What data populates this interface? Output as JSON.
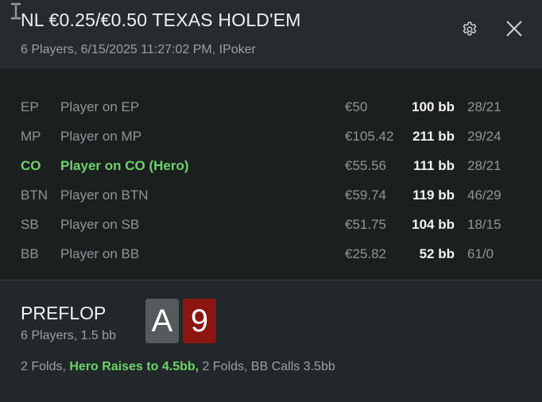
{
  "colors": {
    "background": "#22272a",
    "header_background": "#262b2e",
    "players_background": "#1b201f",
    "hero_accent": "#6cd36a",
    "card_a_background": "#555a5c",
    "card_9_background": "#8b1510"
  },
  "header": {
    "title": "NL €0.25/€0.50 TEXAS HOLD'EM",
    "subtitle": "6 Players, 6/15/2025 11:27:02 PM, IPoker",
    "settings_icon": "gear-icon",
    "close_icon": "close-icon"
  },
  "players": [
    {
      "position": "EP",
      "name": "Player on EP",
      "stack": "€50",
      "bb": "100 bb",
      "stats": "28/21",
      "hero": false
    },
    {
      "position": "MP",
      "name": "Player on MP",
      "stack": "€105.42",
      "bb": "211 bb",
      "stats": "29/24",
      "hero": false
    },
    {
      "position": "CO",
      "name": "Player on CO (Hero)",
      "stack": "€55.56",
      "bb": "111 bb",
      "stats": "28/21",
      "hero": true
    },
    {
      "position": "BTN",
      "name": "Player on BTN",
      "stack": "€59.74",
      "bb": "119 bb",
      "stats": "46/29",
      "hero": false
    },
    {
      "position": "SB",
      "name": "Player on SB",
      "stack": "€51.75",
      "bb": "104 bb",
      "stats": "18/15",
      "hero": false
    },
    {
      "position": "BB",
      "name": "Player on BB",
      "stack": "€25.82",
      "bb": "52 bb",
      "stats": "61/0",
      "hero": false
    }
  ],
  "street": {
    "name": "PREFLOP",
    "subtitle": "6 Players, 1.5 bb",
    "cards": [
      {
        "rank": "A",
        "color": "#555a5c"
      },
      {
        "rank": "9",
        "color": "#8b1510"
      }
    ],
    "actions": {
      "before": "2 Folds,",
      "highlight": "Hero Raises to 4.5bb,",
      "after": "2 Folds, BB Calls 3.5bb"
    }
  }
}
